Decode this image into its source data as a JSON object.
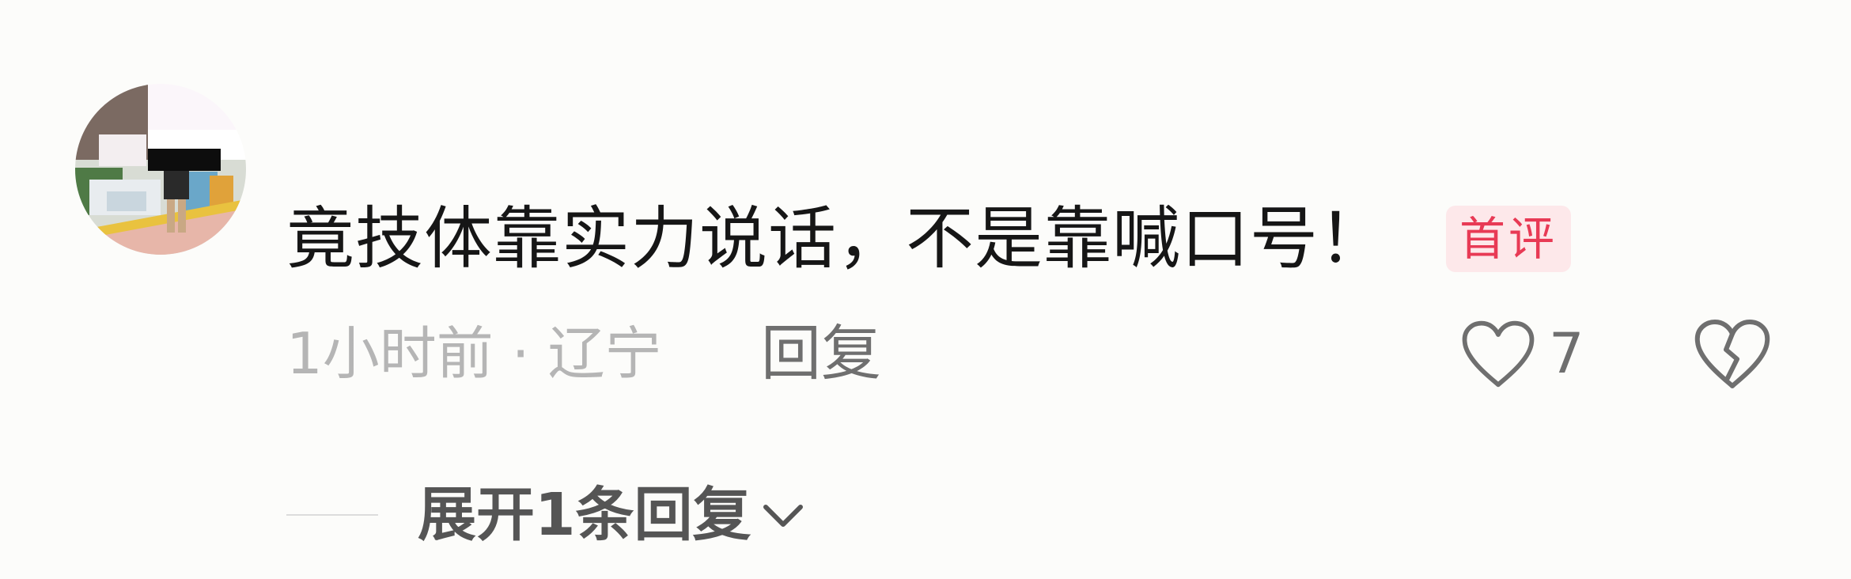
{
  "comment": {
    "text": "竟技体靠实力说话，不是靠喊口号！",
    "badge": "首评",
    "time_location": "1小时前 · 辽宁",
    "reply_label": "回复",
    "like_count": "7",
    "expand_replies_label": "展开1条回复"
  },
  "icons": {
    "like": "heart-outline-icon",
    "dislike": "broken-heart-icon",
    "expand": "chevron-down-icon"
  },
  "colors": {
    "badge_text": "#e83a55",
    "badge_bg": "#fde8ea",
    "meta_text": "#b5b5b5",
    "action_text": "#6f6f6f"
  }
}
